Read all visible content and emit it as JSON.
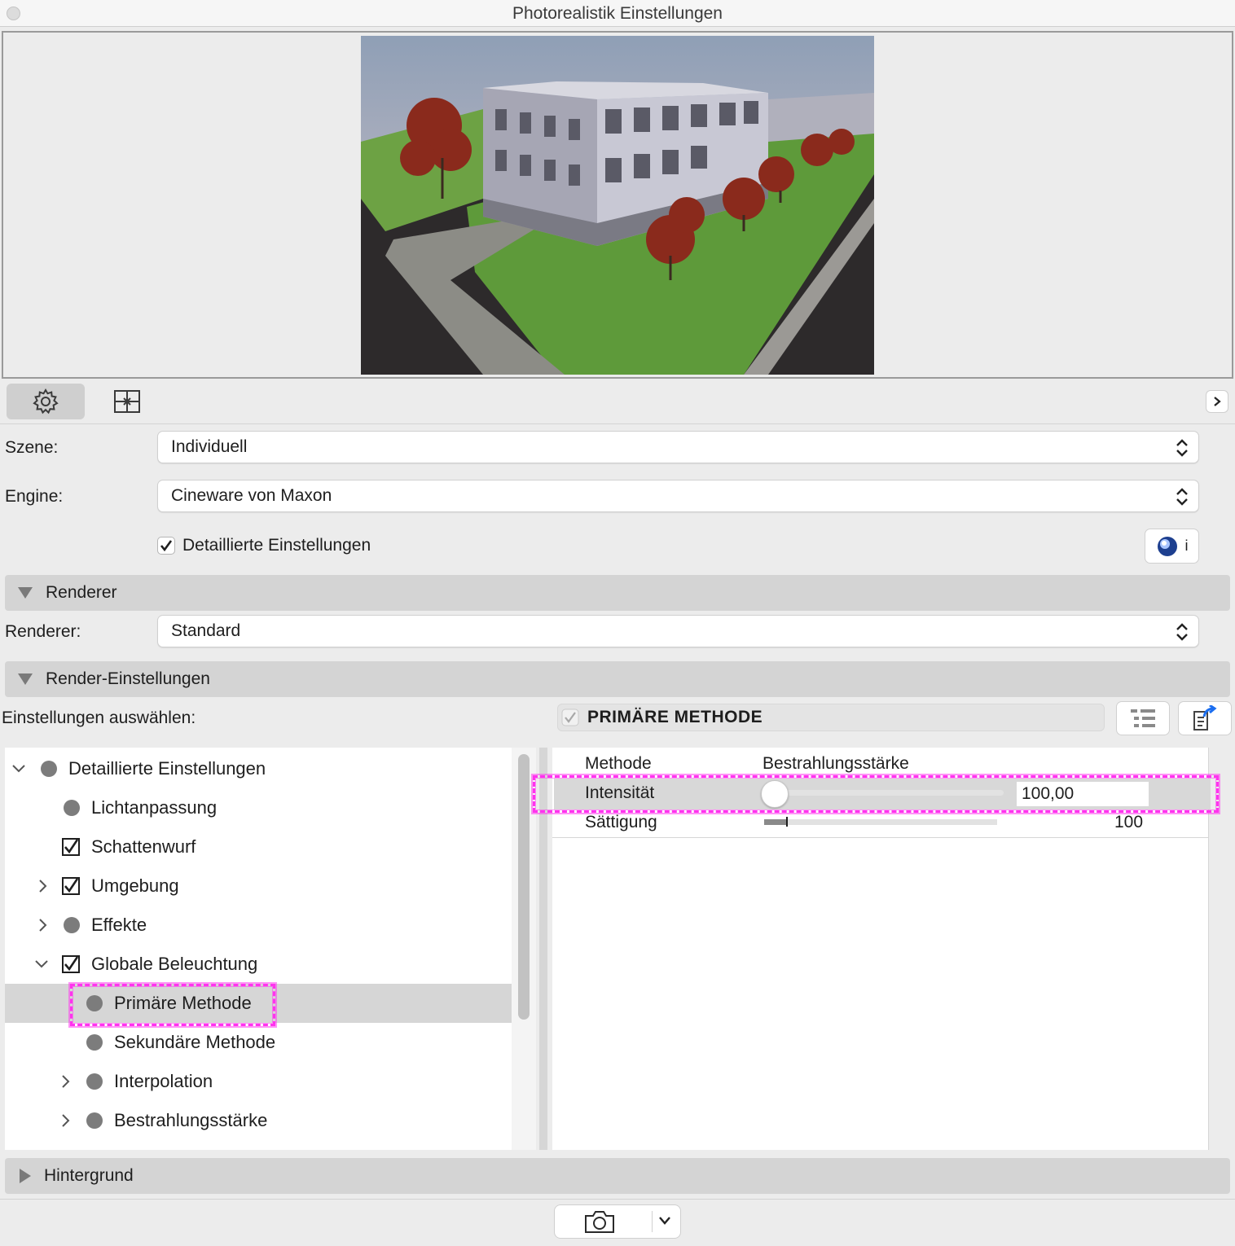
{
  "window": {
    "title": "Photorealistik Einstellungen"
  },
  "tabs": [
    {
      "name": "settings",
      "icon": "gear-icon",
      "selected": true
    },
    {
      "name": "view",
      "icon": "frame-icon",
      "selected": false
    }
  ],
  "form": {
    "scene_label": "Szene:",
    "scene_value": "Individuell",
    "engine_label": "Engine:",
    "engine_value": "Cineware von Maxon",
    "detailed_label": "Detaillierte Einstellungen",
    "detailed_checked": true,
    "cineware_info": "i",
    "renderer_label": "Renderer:",
    "renderer_value": "Standard",
    "select_settings_label": "Einstellungen auswählen:"
  },
  "sections": {
    "renderer": "Renderer",
    "render_settings": "Render-Einstellungen",
    "background": "Hintergrund"
  },
  "tree": {
    "items": [
      {
        "label": "Detaillierte Einstellungen",
        "kind": "dot",
        "expanded": true
      },
      {
        "label": "Lichtanpassung",
        "kind": "dot"
      },
      {
        "label": "Schattenwurf",
        "kind": "checkbox"
      },
      {
        "label": "Umgebung",
        "kind": "checkbox",
        "expanded": false
      },
      {
        "label": "Effekte",
        "kind": "dot",
        "expanded": false
      },
      {
        "label": "Globale Beleuchtung",
        "kind": "checkbox",
        "expanded": true
      },
      {
        "label": "Primäre Methode",
        "kind": "dot",
        "selected": true
      },
      {
        "label": "Sekundäre Methode",
        "kind": "dot"
      },
      {
        "label": "Interpolation",
        "kind": "dot",
        "expanded": false
      },
      {
        "label": "Bestrahlungsstärke",
        "kind": "dot",
        "expanded": false
      }
    ]
  },
  "props": {
    "header": "PRIMÄRE METHODE",
    "method_label": "Methode",
    "method_value": "Bestrahlungsstärke",
    "intensity_label": "Intensität",
    "intensity_value": "100,00",
    "saturation_label": "Sättigung",
    "saturation_value": "100",
    "saturation_level": 0.1
  },
  "colors": {
    "highlight": "#ff33ee",
    "section_bg": "#d4d4d4",
    "window_bg": "#ececec"
  }
}
